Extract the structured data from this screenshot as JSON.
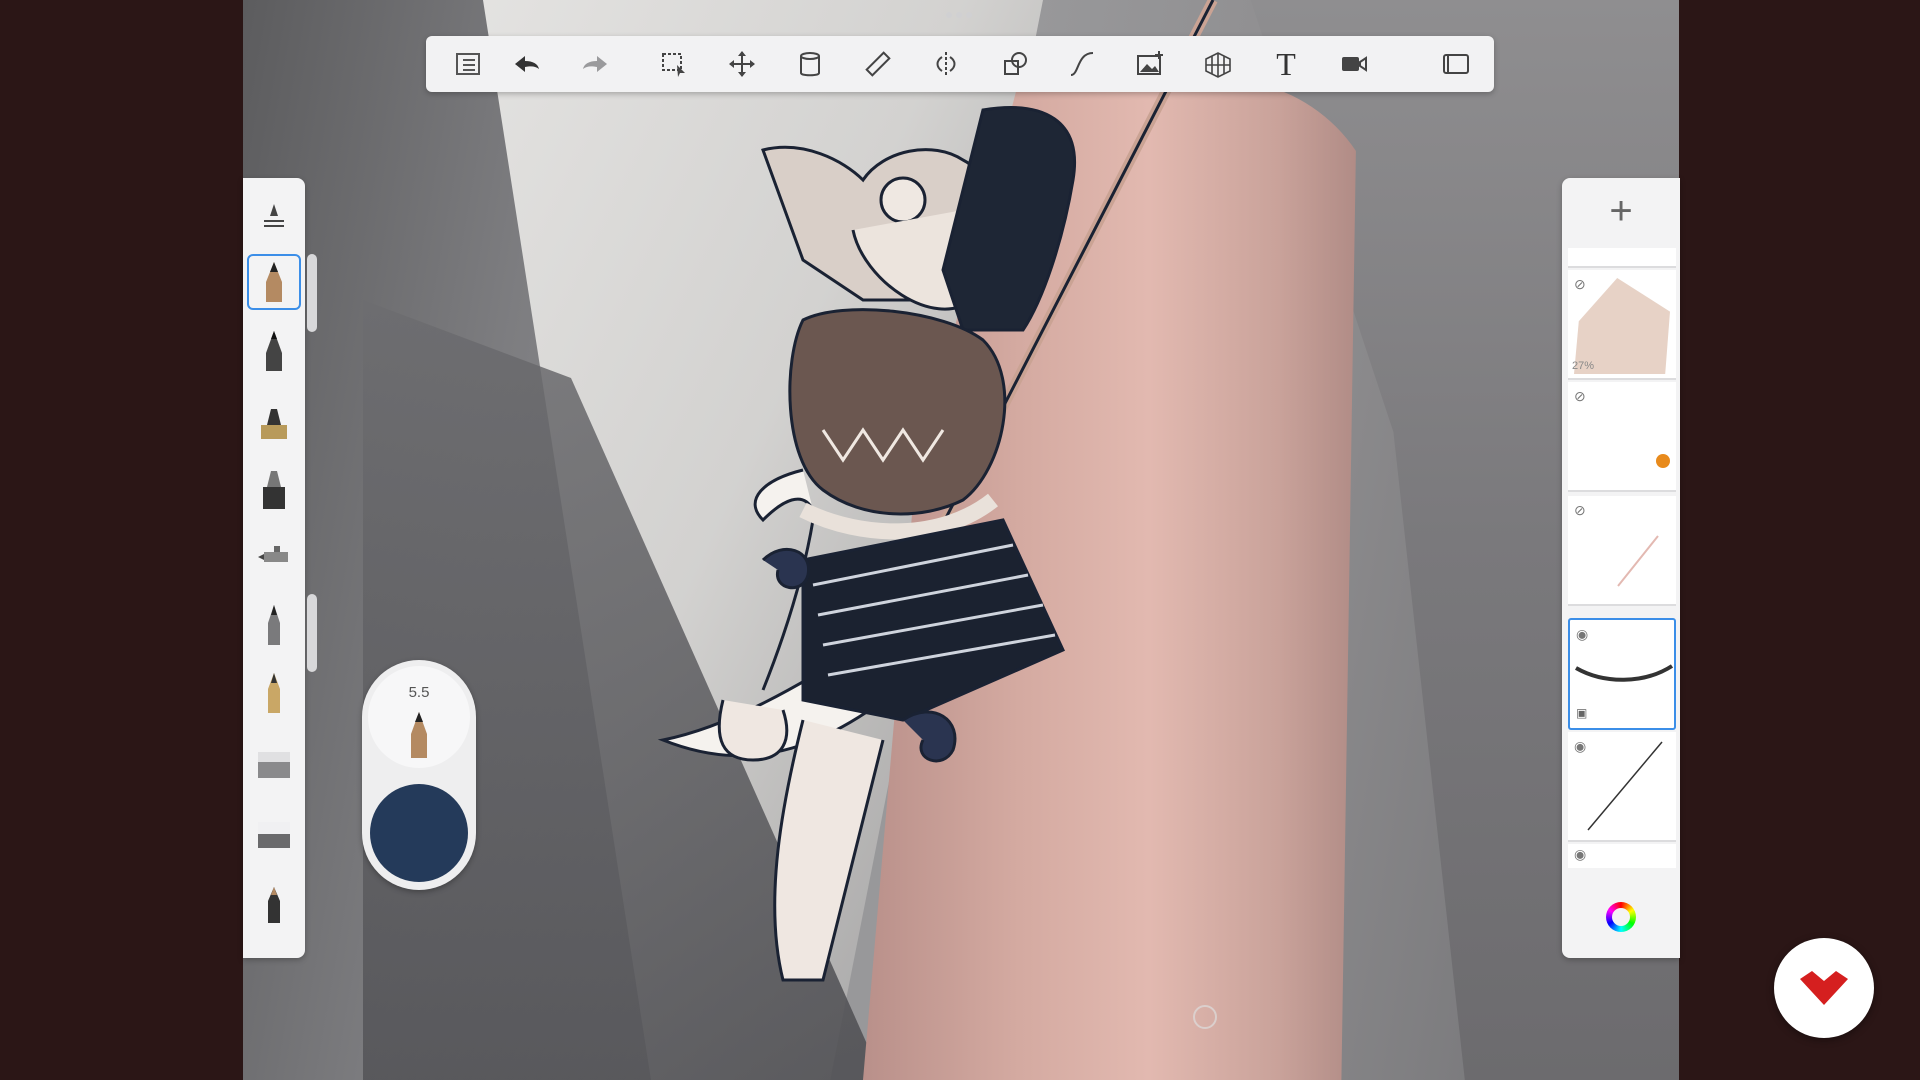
{
  "toolbar": {
    "tools": [
      {
        "name": "layers-list-icon"
      },
      {
        "name": "undo-icon"
      },
      {
        "name": "redo-icon"
      },
      {
        "name": "selection-icon"
      },
      {
        "name": "transform-icon"
      },
      {
        "name": "fill-icon"
      },
      {
        "name": "ruler-icon"
      },
      {
        "name": "symmetry-icon"
      },
      {
        "name": "shapes-icon"
      },
      {
        "name": "curve-icon"
      },
      {
        "name": "import-image-icon"
      },
      {
        "name": "perspective-icon"
      },
      {
        "name": "text-icon"
      },
      {
        "name": "record-icon"
      },
      {
        "name": "fullscreen-icon"
      }
    ],
    "text_tool_label": "T"
  },
  "brush_puck": {
    "size_value": "5.5",
    "color": "#243a5a"
  },
  "layers": {
    "add_label": "+",
    "items": [
      {
        "visibility": "hidden",
        "opacity_label": "27%"
      },
      {
        "visibility": "hidden"
      },
      {
        "visibility": "hidden"
      },
      {
        "visibility": "visible",
        "selected": true
      },
      {
        "visibility": "visible"
      }
    ]
  },
  "colors": {
    "accent": "#3b8ee8",
    "brand": "#d51f1f",
    "ink": "#243a5a"
  }
}
